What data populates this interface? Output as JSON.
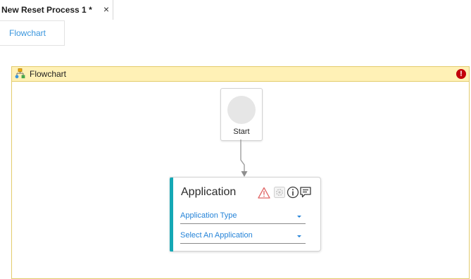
{
  "tab": {
    "title": "New Reset Process 1 *",
    "close_symbol": "×"
  },
  "breadcrumb": {
    "label": "Flowchart"
  },
  "flowchart": {
    "title": "Flowchart",
    "error_symbol": "!"
  },
  "start_node": {
    "label": "Start"
  },
  "application_activity": {
    "title": "Application",
    "dropdowns": [
      {
        "value": "Application Type"
      },
      {
        "value": "Select An Application"
      }
    ]
  },
  "colors": {
    "header_bg": "#fff1b6",
    "header_border": "#e3cc6c",
    "link_blue": "#3a96dd",
    "accent_teal": "#15a8b5",
    "error_red": "#c3000b",
    "warning_red": "#e06666"
  },
  "icons": [
    "close-icon",
    "flowchart-icon",
    "error-icon",
    "warning-icon",
    "settings-icon",
    "info-icon",
    "comment-icon",
    "chevron-down-icon"
  ]
}
